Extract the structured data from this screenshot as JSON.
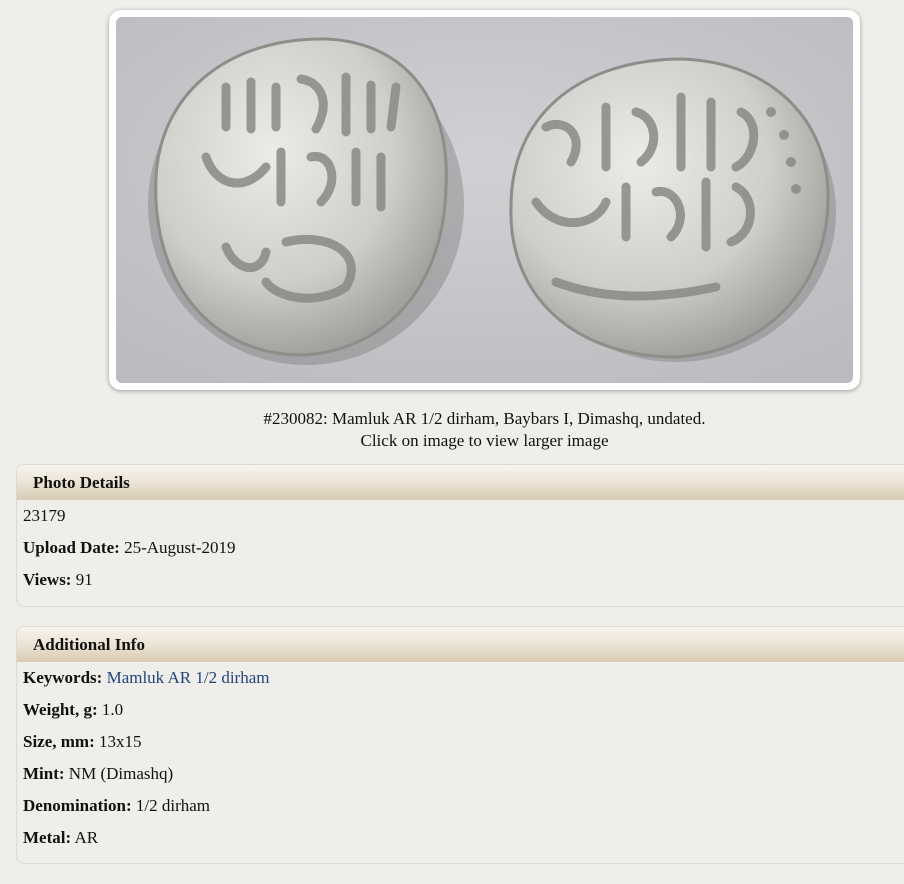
{
  "photo": {
    "alt": "Mamluk AR 1/2 dirham, Baybars I, Dimashq",
    "caption_line1": "#230082: Mamluk AR 1/2 dirham, Baybars I, Dimashq, undated.",
    "caption_line2": "Click on image to view larger image"
  },
  "photo_details": {
    "heading": "Photo Details",
    "id": "23179",
    "upload_date_label": "Upload Date:",
    "upload_date": "25-August-2019",
    "views_label": "Views:",
    "views": "91"
  },
  "additional_info": {
    "heading": "Additional Info",
    "keywords_label": "Keywords:",
    "keywords": "Mamluk AR 1/2 dirham",
    "weight_label": "Weight, g:",
    "weight": "1.0",
    "size_label": "Size, mm:",
    "size": "13x15",
    "mint_label": "Mint:",
    "mint": "NM (Dimashq)",
    "denomination_label": "Denomination:",
    "denomination": "1/2 dirham",
    "metal_label": "Metal:",
    "metal": "AR"
  },
  "colors": {
    "background": "#efeeea",
    "link": "#23457e",
    "coin_silver": "#d9d9d6"
  }
}
